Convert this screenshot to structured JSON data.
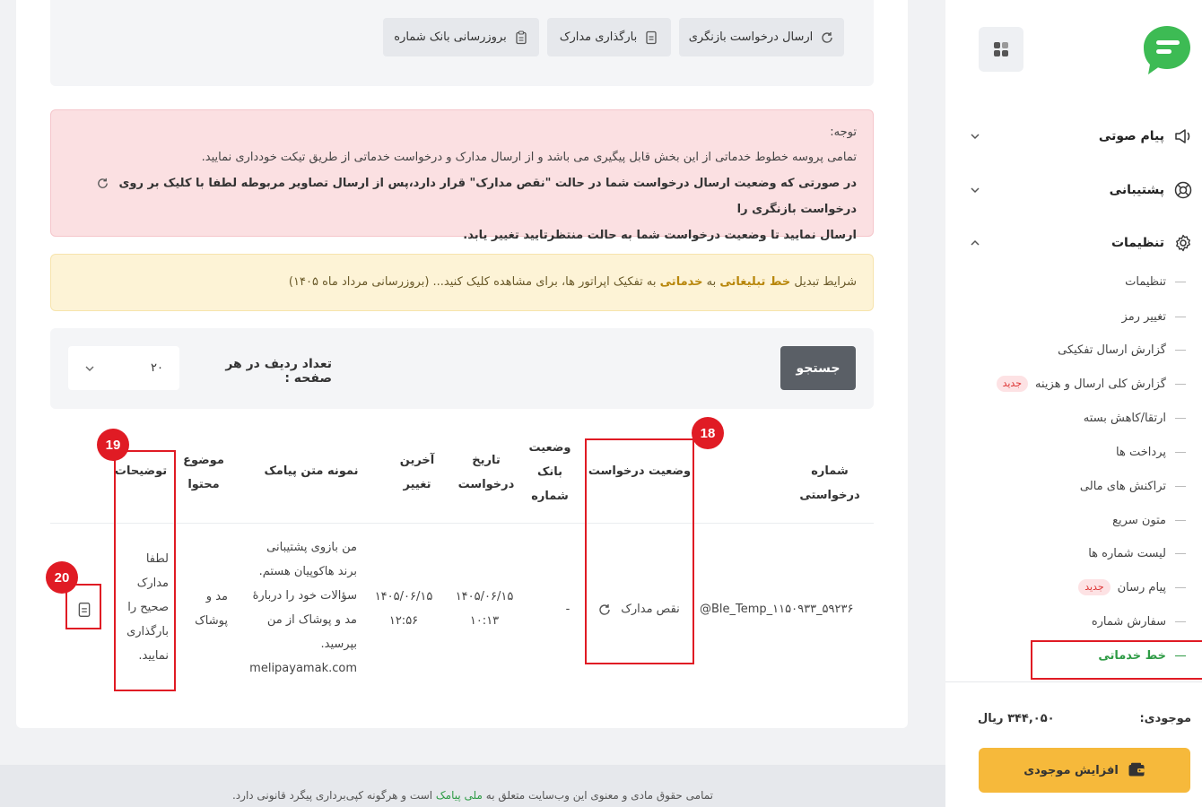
{
  "top_actions": {
    "resend_request": "ارسال درخواست بازنگری",
    "upload_docs": "بارگذاری مدارک",
    "update_bank": "بروزرسانی بانک شماره"
  },
  "notice": {
    "title": "توجه:",
    "line1": "تمامی پروسه خطوط خدماتی از این بخش قابل پیگیری می باشد و از ارسال مدارک و درخواست خدماتی از طریق تیکت خودداری نمایید.",
    "line2a": "در صورتی که وضعیت ارسال درخواست شما در حالت \"نقص مدارک\" قرار دارد،پس از ارسال تصاویر مربوطه لطفا با کلیک بر روی",
    "line2b": "درخواست بازنگری را",
    "line3": "ارسال نمایید تا وضعیت درخواست شما به حالت منتظرتایید تغییر یابد."
  },
  "conditions": {
    "prefix": "شرایط تبدیل",
    "highlight1": "خط تبلیغاتی",
    "middle": "به",
    "highlight2": "خدماتی",
    "suffix": "به تفکیک اپراتور ها، برای مشاهده کلیک کنید... (بروزرسانی مرداد ماه ۱۴۰۵)"
  },
  "search": {
    "button": "جستجو",
    "rows_label": "تعداد ردیف در هر صفحه :",
    "rows_value": "۲۰"
  },
  "table": {
    "headers": {
      "request_number": "شماره درخواستی",
      "request_status": "وضعیت درخواست",
      "bank_status_1": "وضعیت",
      "bank_status_2": "بانک",
      "bank_status_3": "شماره",
      "request_date_1": "تاریخ",
      "request_date_2": "درخواست",
      "last_change_1": "آخرین",
      "last_change_2": "تغییر",
      "sms_sample": "نمونه متن پیامک",
      "content_subject_1": "موضوع",
      "content_subject_2": "محتوا",
      "description": "توضیحات"
    },
    "rows": [
      {
        "request_number": "@Ble_Temp_۱۱۵۰۹۳۳_۵۹۲۳۶",
        "status": "نقص مدارک",
        "bank_status": "-",
        "request_date_1": "۱۴۰۵/۰۶/۱۵",
        "request_date_2": "۱۰:۱۳",
        "last_change_1": "۱۴۰۵/۰۶/۱۵",
        "last_change_2": "۱۲:۵۶",
        "sms_1": "من بازوی پشتیبانی",
        "sms_2": "برند هاکوپیان هستم.",
        "sms_3": "سؤالات خود را دربارهٔ",
        "sms_4": "مد و پوشاک از من",
        "sms_5": "بپرسید.",
        "sms_6": "melipayamak.com",
        "subject_1": "مد و",
        "subject_2": "پوشاک",
        "desc_1": "لطفا",
        "desc_2": "مدارک",
        "desc_3": "صحیح را",
        "desc_4": "بارگذاری",
        "desc_5": "نمایید."
      }
    ]
  },
  "annotations": {
    "badge_18": "18",
    "badge_19": "19",
    "badge_20": "20"
  },
  "footer": {
    "prefix": "تمامی حقوق مادی و معنوی این وب‌سایت متعلق به",
    "brand": "ملی پیامک",
    "suffix": "است و هرگونه کپی‌برداری پیگرد قانونی دارد."
  },
  "sidebar": {
    "main_items": [
      {
        "label": "پیام صوتی",
        "icon": "speaker-icon"
      },
      {
        "label": "پشتیبانی",
        "icon": "lifebuoy-icon"
      },
      {
        "label": "تنظیمات",
        "icon": "gear-icon"
      }
    ],
    "sub_items": [
      {
        "label": "تنظیمات"
      },
      {
        "label": "تغییر رمز"
      },
      {
        "label": "گزارش ارسال تفکیکی"
      },
      {
        "label": "گزارش کلی ارسال و هزینه",
        "tag": "جدید"
      },
      {
        "label": "ارتقا/کاهش بسته"
      },
      {
        "label": "پرداخت ها"
      },
      {
        "label": "تراکنش های مالی"
      },
      {
        "label": "متون سریع"
      },
      {
        "label": "لیست شماره ها"
      },
      {
        "label": "پیام رسان",
        "tag": "جدید"
      },
      {
        "label": "سفارش شماره"
      },
      {
        "label": "خط خدماتی"
      }
    ],
    "balance_label": "موجودی:",
    "balance_value": "۳۴۴,۰۵۰ ریال",
    "topup_button": "افزایش موجودی"
  },
  "colors": {
    "accent_green": "#2e9b45",
    "annotation_red": "#e01b24",
    "topup_yellow": "#f6b93b"
  }
}
